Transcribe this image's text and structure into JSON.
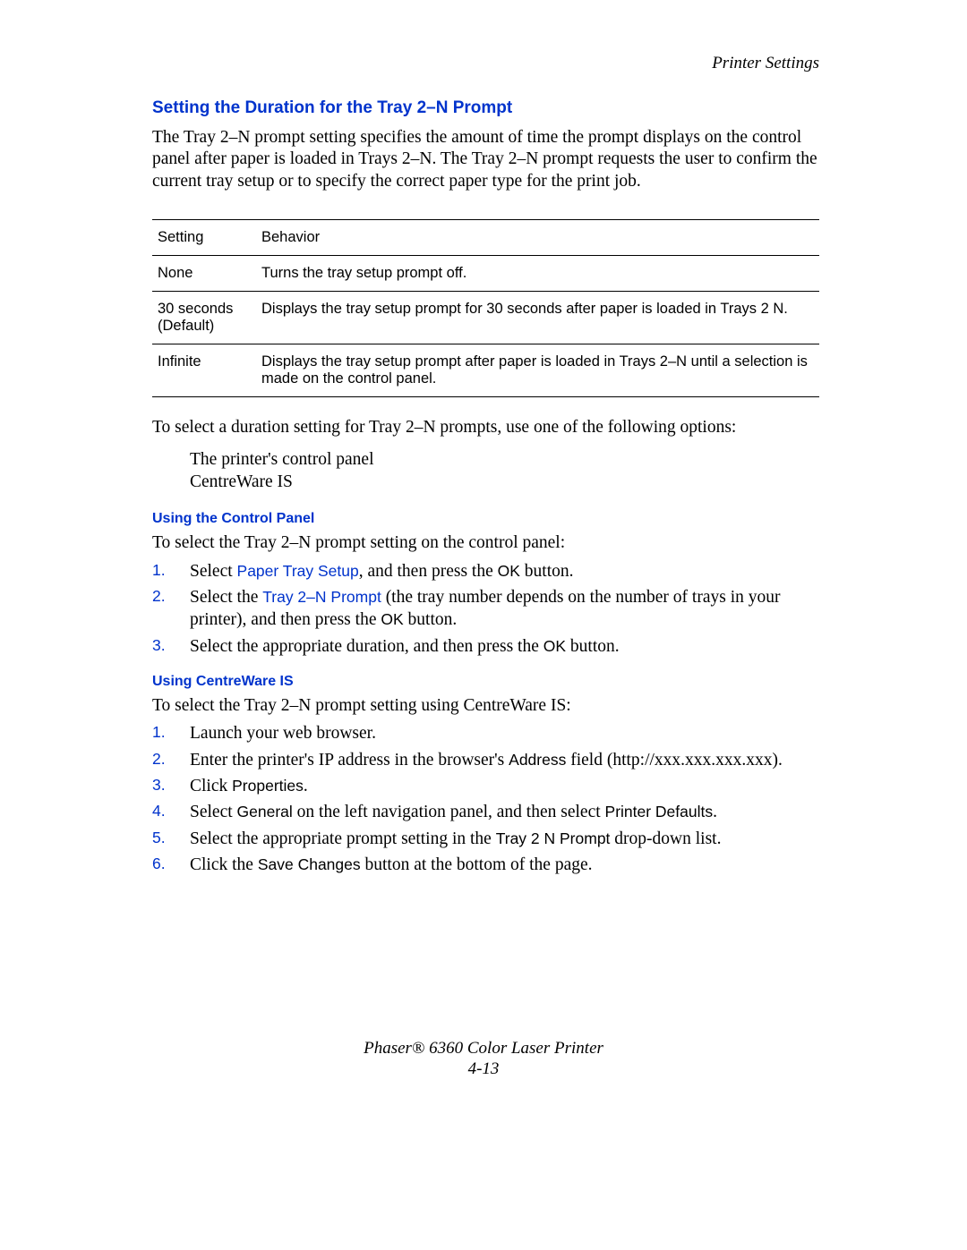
{
  "header_right": "Printer Settings",
  "title": "Setting the Duration for the Tray 2–N Prompt",
  "intro": "The Tray 2–N prompt setting specifies the amount of time the prompt displays on the control panel after paper is loaded in Trays 2–N. The Tray 2–N prompt requests the user to confirm the current tray setup or to specify the correct paper type for the print job.",
  "table": {
    "h1": "Setting",
    "h2": "Behavior",
    "rows": [
      {
        "s": "None",
        "b": "Turns the tray setup prompt off."
      },
      {
        "s": "30 seconds (Default)",
        "b": "Displays the tray setup prompt for 30 seconds after paper is loaded in Trays 2 N."
      },
      {
        "s": "Infinite",
        "b": "Displays the tray setup prompt after paper is loaded in Trays 2–N until a selection is made on the control panel."
      }
    ]
  },
  "select_intro": "To select a duration setting for Tray 2–N prompts, use one of the following options:",
  "options": {
    "a": "The printer's control panel",
    "b": "CentreWare IS"
  },
  "cp": {
    "heading": "Using the Control Panel",
    "intro": "To select the Tray 2–N prompt setting on the control panel:",
    "s1a": "Select ",
    "s1b": "Paper Tray Setup",
    "s1c": ", and then press the ",
    "s1d": "OK",
    "s1e": " button.",
    "s2a": "Select the ",
    "s2b": "Tray 2–N Prompt",
    "s2c": " (the tray number depends on the number of trays in your printer), and then press the ",
    "s2d": "OK",
    "s2e": " button.",
    "s3a": "Select the appropriate duration, and then press the ",
    "s3b": "OK",
    "s3c": " button."
  },
  "cw": {
    "heading": "Using CentreWare IS",
    "intro": "To select the Tray 2–N prompt setting using CentreWare IS:",
    "s1": "Launch your web browser.",
    "s2a": "Enter the printer's IP address in the browser's ",
    "s2b": "Address",
    "s2c": " field (http://xxx.xxx.xxx.xxx).",
    "s3a": "Click ",
    "s3b": "Properties",
    "s3c": ".",
    "s4a": "Select ",
    "s4b": "General",
    "s4c": " on the left navigation panel, and then select ",
    "s4d": "Printer Defaults",
    "s4e": ".",
    "s5a": "Select the appropriate prompt setting in the ",
    "s5b": "Tray 2 N Prompt",
    "s5c": " drop-down list.",
    "s6a": "Click the ",
    "s6b": "Save Changes",
    "s6c": " button at the bottom of the page."
  },
  "footer": {
    "a": "Phaser® 6360 Color Laser Printer",
    "b": "4-13"
  },
  "nums": {
    "n1": "1.",
    "n2": "2.",
    "n3": "3.",
    "n4": "4.",
    "n5": "5.",
    "n6": "6."
  }
}
